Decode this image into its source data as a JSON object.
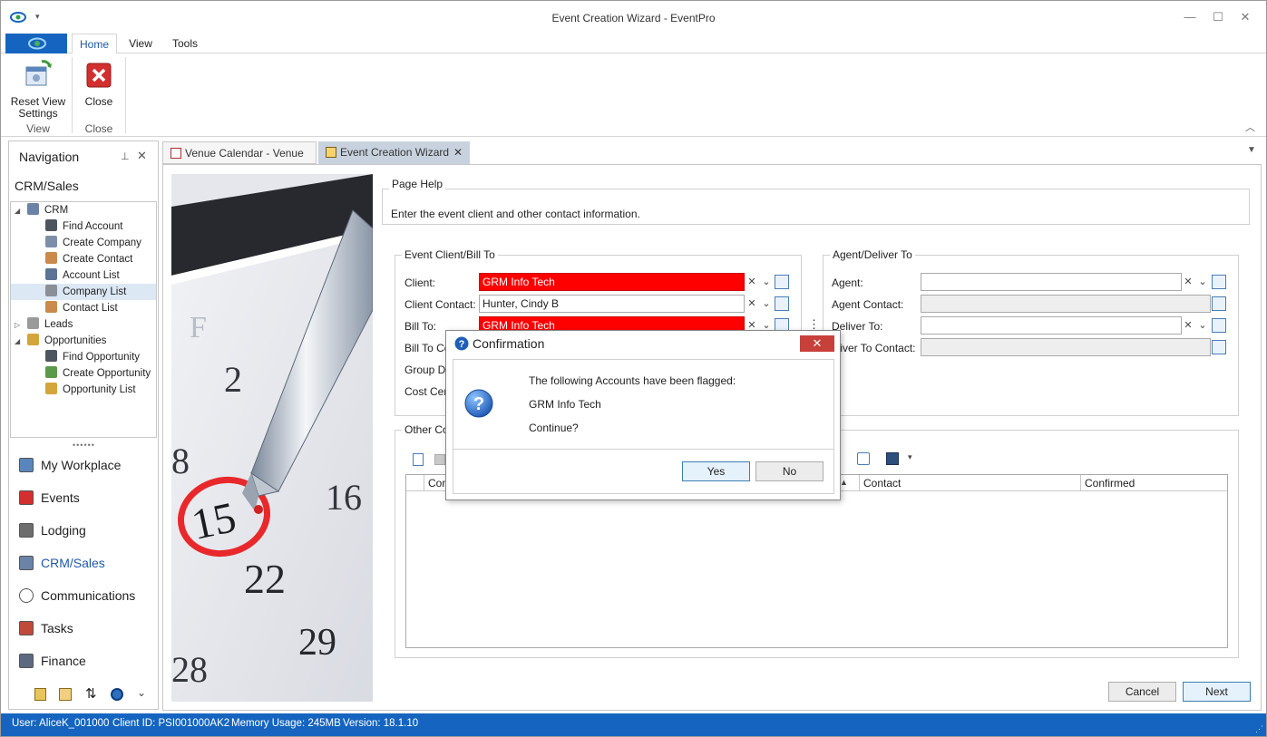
{
  "window": {
    "title": "Event Creation Wizard - EventPro",
    "minimize": "—",
    "maximize": "☐",
    "close": "✕"
  },
  "ribbon": {
    "tabs": [
      "Home",
      "View",
      "Tools"
    ],
    "buttons": {
      "reset_view": "Reset View Settings",
      "close": "Close"
    },
    "groups": {
      "view": "View",
      "close": "Close"
    }
  },
  "navigation": {
    "title": "Navigation",
    "section": "CRM/Sales",
    "tree": [
      {
        "label": "CRM",
        "icon": "crm-icon",
        "level": 0,
        "expander": "◢"
      },
      {
        "label": "Find Account",
        "icon": "binoculars-icon",
        "level": 1
      },
      {
        "label": "Create Company",
        "icon": "create-company-icon",
        "level": 1
      },
      {
        "label": "Create Contact",
        "icon": "create-contact-icon",
        "level": 1
      },
      {
        "label": "Account List",
        "icon": "account-list-icon",
        "level": 1
      },
      {
        "label": "Company List",
        "icon": "company-list-icon",
        "level": 1,
        "selected": true
      },
      {
        "label": "Contact List",
        "icon": "contact-list-icon",
        "level": 1
      },
      {
        "label": "Leads",
        "icon": "leads-icon",
        "level": 0,
        "expander": "▷"
      },
      {
        "label": "Opportunities",
        "icon": "opportunities-icon",
        "level": 0,
        "expander": "◢"
      },
      {
        "label": "Find Opportunity",
        "icon": "binoculars-icon",
        "level": 1
      },
      {
        "label": "Create Opportunity",
        "icon": "create-opportunity-icon",
        "level": 1
      },
      {
        "label": "Opportunity List",
        "icon": "opportunity-list-icon",
        "level": 1
      }
    ],
    "modules": [
      {
        "label": "My Workplace",
        "icon": "home-icon"
      },
      {
        "label": "Events",
        "icon": "pin-icon"
      },
      {
        "label": "Lodging",
        "icon": "lodging-icon"
      },
      {
        "label": "CRM/Sales",
        "icon": "crm-sales-icon",
        "active": true
      },
      {
        "label": "Communications",
        "icon": "speech-bubble-icon"
      },
      {
        "label": "Tasks",
        "icon": "tasks-icon"
      },
      {
        "label": "Finance",
        "icon": "finance-icon"
      }
    ]
  },
  "doc_tabs": {
    "venue_calendar": "Venue Calendar - Venue",
    "event_wizard": "Event Creation Wizard"
  },
  "page_help": {
    "title": "Page Help",
    "text": "Enter the event client and other contact information."
  },
  "client_box": {
    "title": "Event Client/Bill To",
    "client_label": "Client:",
    "client_value": "GRM Info Tech",
    "client_contact_label": "Client Contact:",
    "client_contact_value": "Hunter, Cindy B",
    "bill_to_label": "Bill To:",
    "bill_to_value": "GRM Info Tech",
    "bill_to_contact_label": "Bill To Con",
    "group_disc_label": "Group Dis",
    "cost_center_label": "Cost Cen"
  },
  "agent_box": {
    "title": "Agent/Deliver To",
    "agent_label": "Agent:",
    "agent_contact_label": "Agent Contact:",
    "deliver_to_label": "Deliver To:",
    "deliver_to_contact_label": "eliver To Contact:"
  },
  "other_contacts": {
    "title": "Other Co",
    "columns": [
      "Con",
      "Contact",
      "Confirmed"
    ]
  },
  "footer": {
    "cancel": "Cancel",
    "next": "Next"
  },
  "dialog": {
    "title": "Confirmation",
    "line1": "The following Accounts have been flagged:",
    "line2": "GRM Info Tech",
    "line3": "Continue?",
    "yes": "Yes",
    "no": "No",
    "close": "✕"
  },
  "status": {
    "user": "User: AliceK_001000",
    "client_id": "Client ID: PSI001000AK2",
    "memory": "Memory Usage: 245MB",
    "version": "Version: 18.1.10"
  },
  "colors": {
    "brand_blue": "#1565c0",
    "flag_red": "#ff0000",
    "link_blue": "#1e5aa8"
  }
}
